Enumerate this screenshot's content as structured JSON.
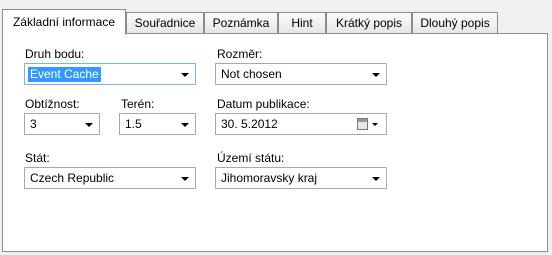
{
  "tabs": [
    "Základní informace",
    "Souřadnice",
    "Poznámka",
    "Hint",
    "Krátký popis",
    "Dlouhý popis"
  ],
  "form": {
    "druh_bodu": {
      "label": "Druh bodu:",
      "value": "Event Cache"
    },
    "rozmer": {
      "label": "Rozměr:",
      "value": "Not chosen"
    },
    "obtiznost": {
      "label": "Obtížnost:",
      "value": "3"
    },
    "teren": {
      "label": "Terén:",
      "value": "1.5"
    },
    "datum": {
      "label": "Datum publikace:",
      "value": "30.  5.2012"
    },
    "stat": {
      "label": "Stát:",
      "value": "Czech Republic"
    },
    "uzemi": {
      "label": "Území státu:",
      "value": "Jihomoravsky kraj"
    }
  }
}
